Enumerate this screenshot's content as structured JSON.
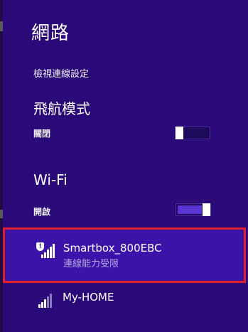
{
  "panel": {
    "title": "網路",
    "view_settings": "檢視連線設定"
  },
  "airplane": {
    "title": "飛航模式",
    "state": "關閉",
    "on": false
  },
  "wifi": {
    "title": "Wi-Fi",
    "state": "開啟",
    "on": true
  },
  "networks": [
    {
      "name": "Smartbox_800EBC",
      "status": "連線能力受限",
      "icon": "wifi-signal-secured-warning-icon",
      "signal_bars": 5,
      "selected": true
    },
    {
      "name": "My-HOME",
      "status": "",
      "icon": "wifi-signal-icon",
      "signal_bars": 3,
      "selected": false
    }
  ],
  "colors": {
    "background": "#2a0a78",
    "selected_item": "#3a14a8",
    "highlight_border": "#e0202a",
    "toggle_fill": "#5b35d4"
  }
}
